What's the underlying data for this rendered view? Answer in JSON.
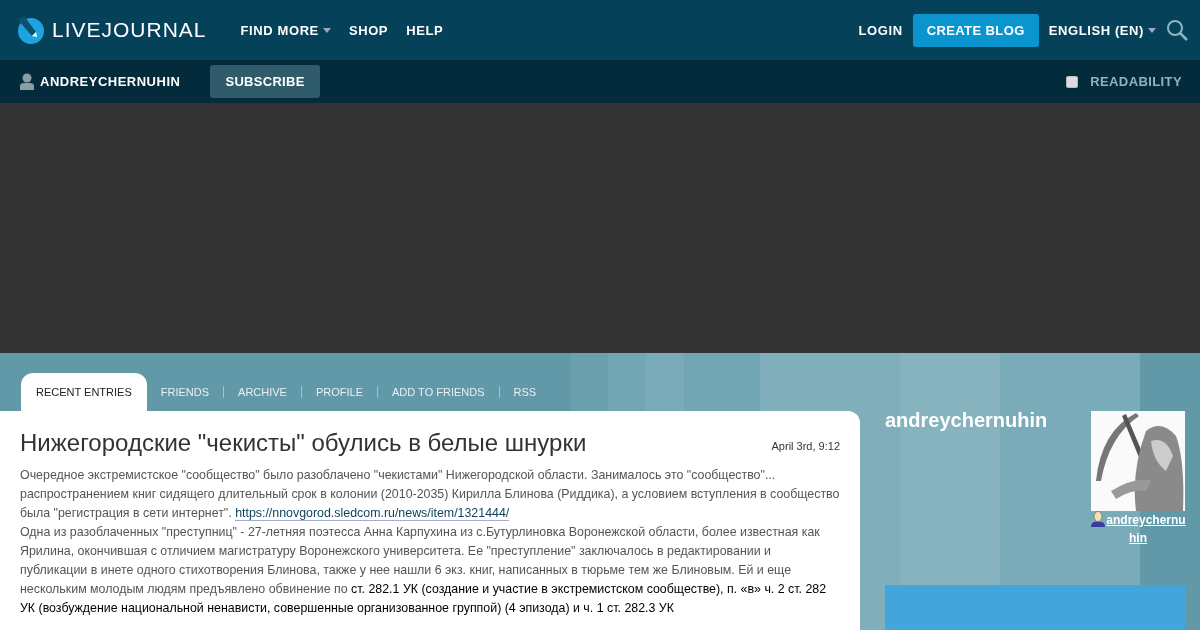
{
  "header": {
    "logo": "LIVEJOURNAL",
    "nav": [
      {
        "label": "FIND MORE",
        "dropdown": true
      },
      {
        "label": "SHOP",
        "dropdown": false
      },
      {
        "label": "HELP",
        "dropdown": false
      }
    ],
    "login": "LOGIN",
    "create_blog": "CREATE BLOG",
    "language": "ENGLISH (EN)"
  },
  "journal_bar": {
    "username": "ANDREYCHERNUHIN",
    "subscribe": "SUBSCRIBE",
    "readability": {
      "label": "READABILITY",
      "checked": false
    }
  },
  "tabs": [
    {
      "label": "RECENT ENTRIES",
      "selected": true
    },
    {
      "label": "FRIENDS",
      "selected": false
    },
    {
      "label": "ARCHIVE",
      "selected": false
    },
    {
      "label": "PROFILE",
      "selected": false
    },
    {
      "label": "ADD TO FRIENDS",
      "selected": false
    },
    {
      "label": "RSS",
      "selected": false
    }
  ],
  "entry": {
    "title": "Нижегородские \"чекисты\" обулись в белые шнурки",
    "date": "April 3rd, 9:12",
    "paragraphs": [
      {
        "text": "Очередное экстремистское \"сообщество\" было разоблачено \"чекистами\" Нижегородской области. Занималось это \"сообщество\"... распространением книг сидящего длительный срок в колонии (2010-2035) Кирилла Блинова (Риддика), а условием вступления в сообщество была \"регистрация в сети интернет\". ",
        "link": "https://nnovgorod.sledcom.ru/news/item/1321444/"
      },
      {
        "text": "Одна из разоблаченных \"преступниц\" - 27-летняя поэтесса Анна Карпухина из с.Бутурлиновка Воронежской области, более известная как Ярилина, окончившая с отличием магистратуру Воронежского университета. Ее \"преступление\" заключалось в редактировании и публикации в инете одного стихотворения Блинова,  также у нее нашли 6 экз. книг, написанных в тюрьме тем же Блиновым. Ей и еще нескольким молодым людям предъявлено обвинение по **ст. 282.1 УК (создание и участие в экстремистском сообществе), п. «в» ч. 2 ст. 282 УК (возбуждение национальной ненависти, совершенные организованное группой) (4 эпизода) и ч. 1 ст. 282.3 УК**"
      }
    ]
  },
  "sidebar": {
    "journal_name": "andreychernuhin",
    "userpic_link": "andreychernuhin"
  }
}
